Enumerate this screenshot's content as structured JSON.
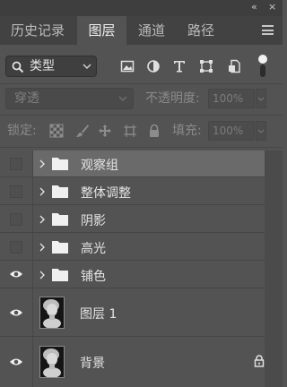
{
  "window": {
    "collapse_glyph": "«",
    "close_glyph": "×"
  },
  "tabs": [
    {
      "label": "历史记录",
      "active": false
    },
    {
      "label": "图层",
      "active": true
    },
    {
      "label": "通道",
      "active": false
    },
    {
      "label": "路径",
      "active": false
    }
  ],
  "filter": {
    "kind_label": "类型",
    "icons": [
      "image-filter-icon",
      "adjustment-filter-icon",
      "type-filter-icon",
      "shape-filter-icon",
      "smart-object-filter-icon"
    ]
  },
  "blend": {
    "mode": "穿透",
    "opacity_label": "不透明度:",
    "opacity_value": "100%"
  },
  "lock": {
    "label": "锁定:",
    "fill_label": "填充:",
    "fill_value": "100%"
  },
  "layers": [
    {
      "name": "观察组",
      "type": "group",
      "visible": false,
      "selected": true
    },
    {
      "name": "整体调整",
      "type": "group",
      "visible": false,
      "selected": false
    },
    {
      "name": "阴影",
      "type": "group",
      "visible": false,
      "selected": false
    },
    {
      "name": "高光",
      "type": "group",
      "visible": false,
      "selected": false
    },
    {
      "name": "铺色",
      "type": "group",
      "visible": true,
      "selected": false
    },
    {
      "name": "图层 1",
      "type": "pixel",
      "visible": true,
      "selected": false,
      "locked": false
    },
    {
      "name": "背景",
      "type": "pixel",
      "visible": true,
      "selected": false,
      "locked": true
    }
  ],
  "colors": {
    "panel_bg": "#535353",
    "tab_bar": "#424242",
    "selected_row": "#6a6a6a"
  }
}
